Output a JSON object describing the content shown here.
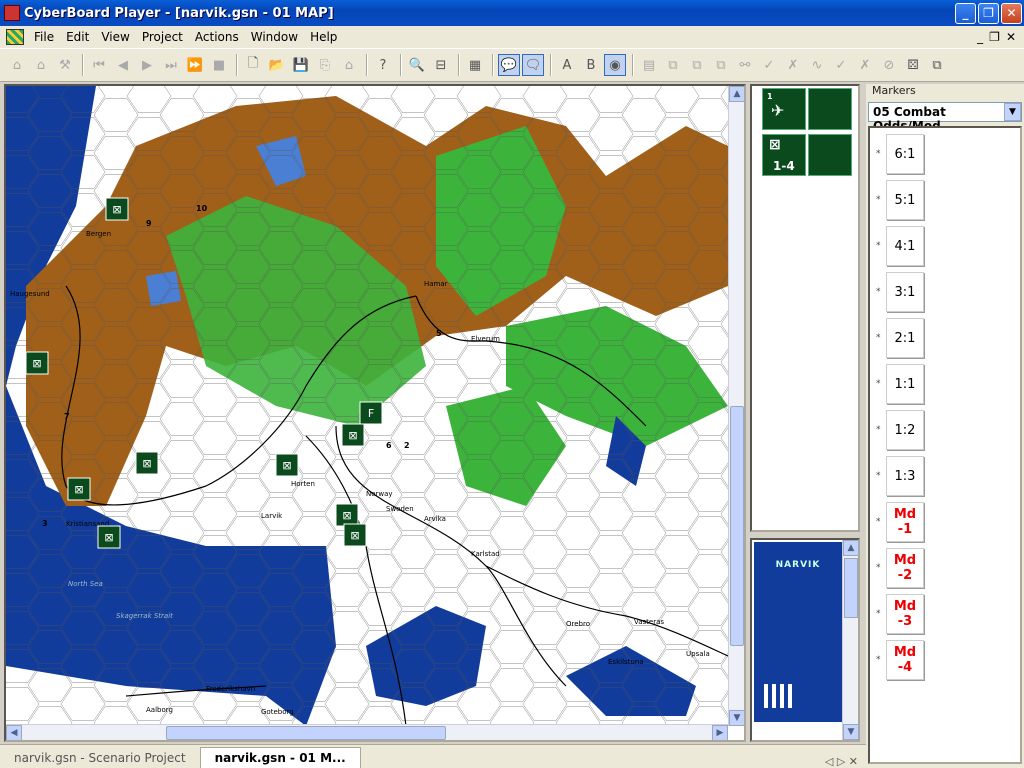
{
  "window": {
    "title": "CyberBoard Player - [narvik.gsn - 01 MAP]"
  },
  "menu": [
    "File",
    "Edit",
    "View",
    "Project",
    "Actions",
    "Window",
    "Help"
  ],
  "map": {
    "labels": [
      "Bergen",
      "Haugesund",
      "Hamar",
      "Elverum",
      "North Sea",
      "Skagerrak Strait",
      "Frederikshavn",
      "Aalborg",
      "Orebro",
      "Vasteras",
      "Eskilstuna",
      "Karlstad",
      "Arvika",
      "Horten",
      "Larvik",
      "Kristiansand",
      "Goteborg",
      "Norway",
      "Sweden",
      "Upsala"
    ],
    "hex_numbers": [
      "10",
      "9",
      "7",
      "6",
      "2",
      "5",
      "3"
    ],
    "unit_codes": [
      "F"
    ]
  },
  "tray": {
    "unit_a": "1",
    "unit_b": "1-4"
  },
  "scenario_card": {
    "title": "NARVIK"
  },
  "markers": {
    "header": "Markers",
    "selected_group": "05 Combat Odds/Mod",
    "items": [
      {
        "label": "6:1",
        "red": false
      },
      {
        "label": "5:1",
        "red": false
      },
      {
        "label": "4:1",
        "red": false
      },
      {
        "label": "3:1",
        "red": false
      },
      {
        "label": "2:1",
        "red": false
      },
      {
        "label": "1:1",
        "red": false
      },
      {
        "label": "1:2",
        "red": false
      },
      {
        "label": "1:3",
        "red": false
      },
      {
        "label": "Md -1",
        "red": true
      },
      {
        "label": "Md -2",
        "red": true
      },
      {
        "label": "Md -3",
        "red": true
      },
      {
        "label": "Md -4",
        "red": true
      }
    ]
  },
  "tabs": [
    "narvik.gsn - Scenario Project",
    "narvik.gsn - 01 M..."
  ],
  "colors": {
    "sea": "#123c9c",
    "mountain": "#a0601a",
    "forest": "#3cb43c",
    "land": "#ffffff",
    "counter": "#0a4a1c"
  }
}
